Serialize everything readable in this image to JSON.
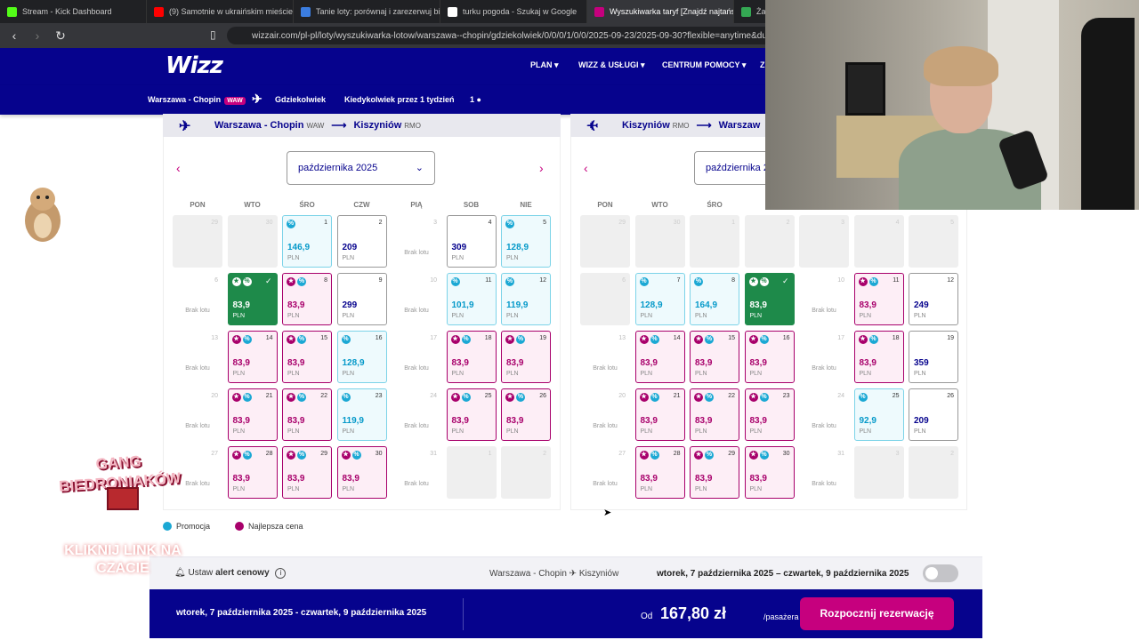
{
  "browser": {
    "tabs": [
      {
        "title": "Stream - Kick Dashboard",
        "fav_color": "#53fc18"
      },
      {
        "title": "(9) Samotnie w ukraińskim mieście n",
        "fav_color": "#ff0000"
      },
      {
        "title": "Tanie loty: porównaj i zarezerwuj bile",
        "fav_color": "#3b7de0"
      },
      {
        "title": "turku pogoda - Szukaj w Google",
        "fav_color": "#ffffff"
      },
      {
        "title": "Wyszukiwarka taryf [Znajdź najtańs",
        "fav_color": "#c6007e"
      },
      {
        "title": "Żab",
        "fav_color": "#34a853"
      }
    ],
    "close_glyph": "✕",
    "url": "wizzair.com/pl-pl/loty/wyszukiwarka-lotow/warszawa--chopin/gdziekolwiek/0/0/0/1/0/0/2025-09-23/2025-09-30?flexible=anytime&durati..."
  },
  "header": {
    "logo": "Wizz",
    "nav": [
      "PLAN",
      "WIZZ & USŁUGI",
      "CENTRUM POMOCY",
      "Z"
    ]
  },
  "search": {
    "origin": "Warszawa - Chopin",
    "origin_code": "WAW",
    "destination": "Gdziekolwiek",
    "when": "Kiedykolwiek przez 1 tydzień",
    "passengers": "1"
  },
  "outbound": {
    "from": "Warszawa - Chopin",
    "from_code": "WAW",
    "to": "Kiszyniów",
    "to_code": "RMO",
    "month": "października 2025",
    "dows": [
      "PON",
      "WTO",
      "ŚRO",
      "CZW",
      "PIĄ",
      "SOB",
      "NIE"
    ],
    "weeks": [
      [
        {
          "d": "29",
          "t": "empty"
        },
        {
          "d": "30",
          "t": "empty"
        },
        {
          "d": "1",
          "t": "promo",
          "p": "146,9"
        },
        {
          "d": "2",
          "t": "regular",
          "p": "209"
        },
        {
          "d": "3",
          "t": "na"
        },
        {
          "d": "4",
          "t": "regular",
          "p": "309"
        },
        {
          "d": "5",
          "t": "promo",
          "p": "128,9"
        }
      ],
      [
        {
          "d": "6",
          "t": "na"
        },
        {
          "d": "7",
          "t": "selected",
          "p": "83,9"
        },
        {
          "d": "8",
          "t": "best",
          "p": "83,9"
        },
        {
          "d": "9",
          "t": "regular",
          "p": "299"
        },
        {
          "d": "10",
          "t": "na"
        },
        {
          "d": "11",
          "t": "promo",
          "p": "101,9"
        },
        {
          "d": "12",
          "t": "promo",
          "p": "119,9"
        }
      ],
      [
        {
          "d": "13",
          "t": "na"
        },
        {
          "d": "14",
          "t": "best",
          "p": "83,9"
        },
        {
          "d": "15",
          "t": "best",
          "p": "83,9"
        },
        {
          "d": "16",
          "t": "promo",
          "p": "128,9"
        },
        {
          "d": "17",
          "t": "na"
        },
        {
          "d": "18",
          "t": "best",
          "p": "83,9"
        },
        {
          "d": "19",
          "t": "best",
          "p": "83,9"
        }
      ],
      [
        {
          "d": "20",
          "t": "na"
        },
        {
          "d": "21",
          "t": "best",
          "p": "83,9"
        },
        {
          "d": "22",
          "t": "best",
          "p": "83,9"
        },
        {
          "d": "23",
          "t": "promo",
          "p": "119,9"
        },
        {
          "d": "24",
          "t": "na"
        },
        {
          "d": "25",
          "t": "best",
          "p": "83,9"
        },
        {
          "d": "26",
          "t": "best",
          "p": "83,9"
        }
      ],
      [
        {
          "d": "27",
          "t": "na"
        },
        {
          "d": "28",
          "t": "best",
          "p": "83,9"
        },
        {
          "d": "29",
          "t": "best",
          "p": "83,9"
        },
        {
          "d": "30",
          "t": "best",
          "p": "83,9"
        },
        {
          "d": "31",
          "t": "na"
        },
        {
          "d": "1",
          "t": "empty"
        },
        {
          "d": "2",
          "t": "empty"
        }
      ]
    ]
  },
  "inbound": {
    "from": "Kiszyniów",
    "from_code": "RMO",
    "to": "Warszaw",
    "month": "października 2",
    "dows": [
      "PON",
      "WTO",
      "ŚRO",
      "C"
    ],
    "weeks": [
      [
        {
          "d": "29",
          "t": "empty"
        },
        {
          "d": "30",
          "t": "empty"
        },
        {
          "d": "1",
          "t": "empty"
        },
        {
          "d": "2",
          "t": "empty"
        },
        {
          "d": "3",
          "t": "empty"
        },
        {
          "d": "4",
          "t": "empty"
        },
        {
          "d": "5",
          "t": "empty"
        }
      ],
      [
        {
          "d": "6",
          "t": "empty"
        },
        {
          "d": "7",
          "t": "promo",
          "p": "128,9"
        },
        {
          "d": "8",
          "t": "promo",
          "p": "164,9"
        },
        {
          "d": "9",
          "t": "selected",
          "p": "83,9"
        },
        {
          "d": "10",
          "t": "na"
        },
        {
          "d": "11",
          "t": "best",
          "p": "83,9"
        },
        {
          "d": "12",
          "t": "regular",
          "p": "249"
        }
      ],
      [
        {
          "d": "13",
          "t": "na"
        },
        {
          "d": "14",
          "t": "best",
          "p": "83,9"
        },
        {
          "d": "15",
          "t": "best",
          "p": "83,9"
        },
        {
          "d": "16",
          "t": "best",
          "p": "83,9"
        },
        {
          "d": "17",
          "t": "na"
        },
        {
          "d": "18",
          "t": "best",
          "p": "83,9"
        },
        {
          "d": "19",
          "t": "regular",
          "p": "359"
        }
      ],
      [
        {
          "d": "20",
          "t": "na"
        },
        {
          "d": "21",
          "t": "best",
          "p": "83,9"
        },
        {
          "d": "22",
          "t": "best",
          "p": "83,9"
        },
        {
          "d": "23",
          "t": "best",
          "p": "83,9"
        },
        {
          "d": "24",
          "t": "na"
        },
        {
          "d": "25",
          "t": "promo",
          "p": "92,9"
        },
        {
          "d": "26",
          "t": "regular",
          "p": "209"
        }
      ],
      [
        {
          "d": "27",
          "t": "na"
        },
        {
          "d": "28",
          "t": "best",
          "p": "83,9"
        },
        {
          "d": "29",
          "t": "best",
          "p": "83,9"
        },
        {
          "d": "30",
          "t": "best",
          "p": "83,9"
        },
        {
          "d": "31",
          "t": "na"
        },
        {
          "d": "3",
          "t": "empty"
        },
        {
          "d": "2",
          "t": "empty"
        }
      ]
    ]
  },
  "labels": {
    "currency": "PLN",
    "no_flight": "Brak lotu"
  },
  "legend": {
    "promo": "Promocja",
    "best": "Najlepsza cena"
  },
  "alert": {
    "prefix": "Ustaw",
    "bold": "alert cenowy",
    "route_from": "Warszawa - Chopin",
    "route_to": "Kiszyniów",
    "dates": "wtorek, 7 października 2025 – czwartek, 9 października 2025"
  },
  "footer": {
    "dates": "wtorek, 7 października 2025 - czwartek, 9 października 2025",
    "from_label": "Od",
    "price": "167,80 zł",
    "per": "/pasażera",
    "book": "Rozpocznij rezerwację"
  },
  "overlay": {
    "title": "GANG BIEDRONIAKÓW",
    "cta": "KLIKNIJ LINK NA CZACIE"
  },
  "colors": {
    "wizz_navy": "#06038d",
    "wizz_magenta": "#c6007e",
    "promo_blue": "#1ba8d4",
    "selected_green": "#1e8a4a"
  }
}
